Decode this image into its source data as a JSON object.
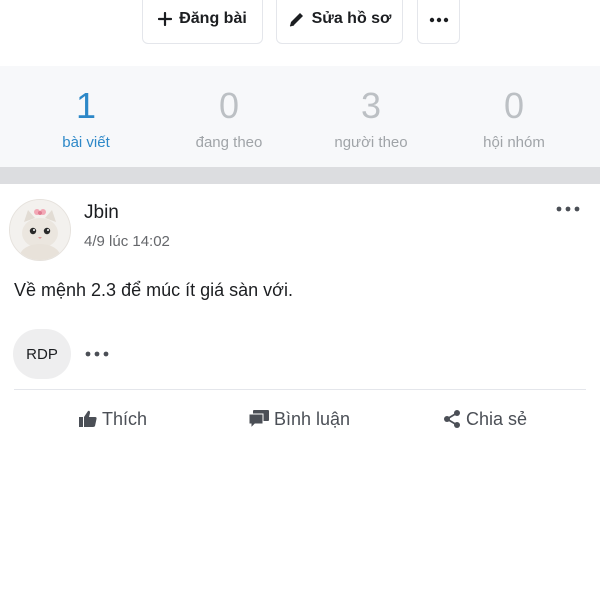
{
  "toolbar": {
    "post_label": "Đăng bài",
    "edit_profile_label": "Sửa hồ sơ",
    "more_label": "···"
  },
  "stats": [
    {
      "count": "1",
      "label": "bài viết",
      "active": true
    },
    {
      "count": "0",
      "label": "đang theo",
      "active": false
    },
    {
      "count": "3",
      "label": "người theo",
      "active": false
    },
    {
      "count": "0",
      "label": "hội nhóm",
      "active": false
    }
  ],
  "post": {
    "author": "Jbin",
    "time": "4/9 lúc 14:02",
    "text": "Về mệnh 2.3 để múc ít giá sàn với.",
    "tag": "RDP",
    "actions": {
      "like": "Thích",
      "comment": "Bình luận",
      "share": "Chia sẻ"
    }
  },
  "colors": {
    "accent": "#2d88c8",
    "muted": "#bcc0c4",
    "stats_bg": "#f7f8fa",
    "divider": "#dcdde0"
  },
  "icons": [
    "plus-icon",
    "pencil-icon",
    "more-dots-icon",
    "thumbs-up-icon",
    "comment-icon",
    "share-icon"
  ]
}
